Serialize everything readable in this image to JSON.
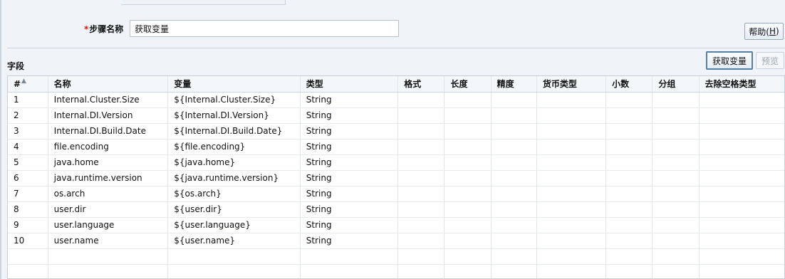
{
  "step": {
    "required_mark": "*",
    "label": "步骤名称",
    "value": "获取变量"
  },
  "help_button": {
    "label": "帮助(",
    "hotkey": "H",
    "suffix": ")"
  },
  "section_label": "字段",
  "buttons": {
    "get_variables": "获取变量",
    "preview": "预览"
  },
  "table": {
    "columns": [
      "#",
      "名称",
      "变量",
      "类型",
      "格式",
      "长度",
      "精度",
      "货币类型",
      "小数",
      "分组",
      "去除空格类型"
    ],
    "rows": [
      [
        "1",
        "Internal.Cluster.Size",
        "${Internal.Cluster.Size}",
        "String"
      ],
      [
        "2",
        "Internal.DI.Version",
        "${Internal.DI.Version}",
        "String"
      ],
      [
        "3",
        "Internal.DI.Build.Date",
        "${Internal.DI.Build.Date}",
        "String"
      ],
      [
        "4",
        "file.encoding",
        "${file.encoding}",
        "String"
      ],
      [
        "5",
        "java.home",
        "${java.home}",
        "String"
      ],
      [
        "6",
        "java.runtime.version",
        "${java.runtime.version}",
        "String"
      ],
      [
        "7",
        "os.arch",
        "${os.arch}",
        "String"
      ],
      [
        "8",
        "user.dir",
        "${user.dir}",
        "String"
      ],
      [
        "9",
        "user.language",
        "${user.language}",
        "String"
      ],
      [
        "10",
        "user.name",
        "${user.name}",
        "String"
      ]
    ]
  }
}
